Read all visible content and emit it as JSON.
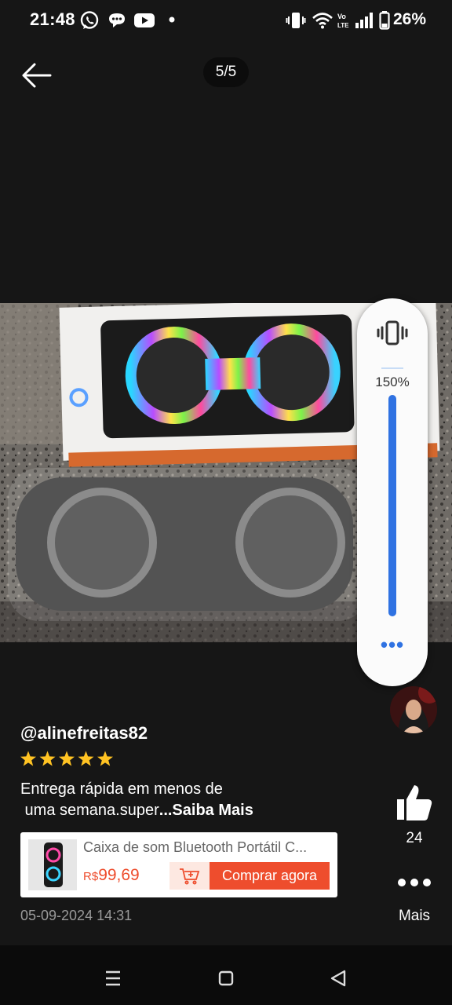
{
  "status_bar": {
    "time": "21:48",
    "battery": "26%",
    "icons": [
      "whatsapp-icon",
      "chat-icon",
      "youtube-icon",
      "dot-icon",
      "vibrate-icon",
      "wifi-icon",
      "volte-icon",
      "signal-icon",
      "battery-icon"
    ]
  },
  "header": {
    "page_indicator": "5/5",
    "back_icon": "arrow-left-icon"
  },
  "volume": {
    "level_label": "150%",
    "level_fraction": 1.0,
    "mode_icon": "vibrate-icon",
    "accent": "#2f72e2"
  },
  "review": {
    "username": "@alinefreitas82",
    "stars": 5,
    "text": "Entrega rápida em menos de\n uma semana.super",
    "read_more": "...Saiba Mais",
    "date": "05-09-2024 14:31",
    "likes": "24",
    "more_label": "Mais"
  },
  "product": {
    "title": "Caixa de som Bluetooth Portátil C...",
    "currency": "R$",
    "price": "99,69",
    "buy_label": "Comprar agora",
    "accent": "#ee4d2d"
  }
}
